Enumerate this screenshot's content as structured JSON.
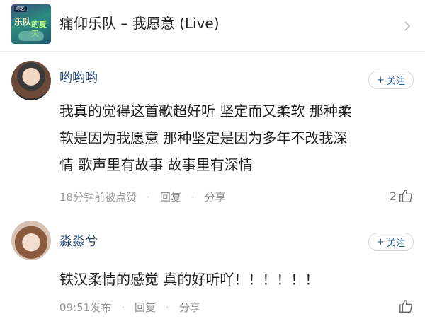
{
  "song": {
    "title": "痛仰乐队 – 我愿意 (Live)",
    "cover": {
      "badge": "综艺",
      "line1": "乐队",
      "line2": "的夏天"
    },
    "chevron_icon": "chevron-right-icon"
  },
  "comments": [
    {
      "username": "哟哟哟",
      "follow_label": "关注",
      "follow_icon": "plus-icon",
      "text": "我真的觉得这首歌超好听 坚定而又柔软 那种柔\n软是因为我愿意 那种坚定是因为多年不改我深\n情 歌声里有故事 故事里有深情",
      "time": "18分钟前被点赞",
      "reply_label": "回复",
      "share_label": "分享",
      "like_count": "2",
      "like_icon": "thumbs-up-icon"
    },
    {
      "username": "淼淼兮",
      "follow_label": "关注",
      "follow_icon": "plus-icon",
      "text": "铁汉柔情的感觉 真的好听吖！！！！！！",
      "time": "09:51发布",
      "reply_label": "回复",
      "share_label": "分享",
      "like_count": "",
      "like_icon": "thumbs-up-icon"
    }
  ],
  "colors": {
    "username": "#2e4f7d",
    "follow": "#2e5f95",
    "meta": "#9a9a9a"
  }
}
